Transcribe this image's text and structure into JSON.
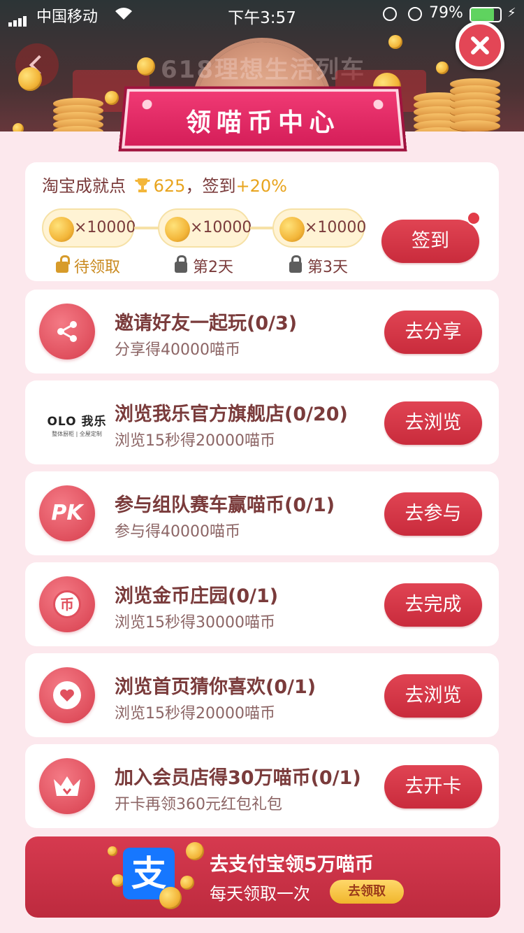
{
  "status_bar": {
    "carrier": "中国移动",
    "time": "下午3:57",
    "battery": "79%",
    "battery_level": 0.79
  },
  "background": {
    "title": "618理想生活列车"
  },
  "header": {
    "title": "领喵币中心"
  },
  "checkin": {
    "achievement_label": "淘宝成就点",
    "achievement_points": "625",
    "separator": "，签到",
    "bonus": "+20%",
    "days": [
      {
        "reward": "×10000",
        "label": "待领取",
        "state": "claimable"
      },
      {
        "reward": "×10000",
        "label": "第2天",
        "state": "locked"
      },
      {
        "reward": "×10000",
        "label": "第3天",
        "state": "locked"
      }
    ],
    "button": "签到"
  },
  "tasks": [
    {
      "title": "邀请好友一起玩(0/3)",
      "subtitle": "分享得40000喵币",
      "button": "去分享",
      "icon": "share-icon"
    },
    {
      "title": "浏览我乐官方旗舰店(0/20)",
      "subtitle": "浏览15秒得20000喵币",
      "button": "去浏览",
      "icon": "olo-brand-logo",
      "brand": {
        "name": "OLO 我乐",
        "tagline": "整体厨柜 | 全屋定制"
      }
    },
    {
      "title": "参与组队赛车赢喵币(0/1)",
      "subtitle": "参与得40000喵币",
      "button": "去参与",
      "icon": "pk-icon",
      "icon_text": "PK"
    },
    {
      "title": "浏览金币庄园(0/1)",
      "subtitle": "浏览15秒得30000喵币",
      "button": "去完成",
      "icon": "coin-icon",
      "icon_text": "币"
    },
    {
      "title": "浏览首页猜你喜欢(0/1)",
      "subtitle": "浏览15秒得20000喵币",
      "button": "去浏览",
      "icon": "heart-icon"
    },
    {
      "title": "加入会员店得30万喵币(0/1)",
      "subtitle": "开卡再领360元红包礼包",
      "button": "去开卡",
      "icon": "crown-icon"
    }
  ],
  "alipay": {
    "title": "去支付宝领5万喵币",
    "subtitle": "每天领取一次",
    "button": "去领取",
    "logo_text": "支"
  },
  "colors": {
    "accent": "#d63547",
    "gold": "#e8a41e",
    "pink_bg": "#fce8ed",
    "alipay_blue": "#1677ff"
  }
}
